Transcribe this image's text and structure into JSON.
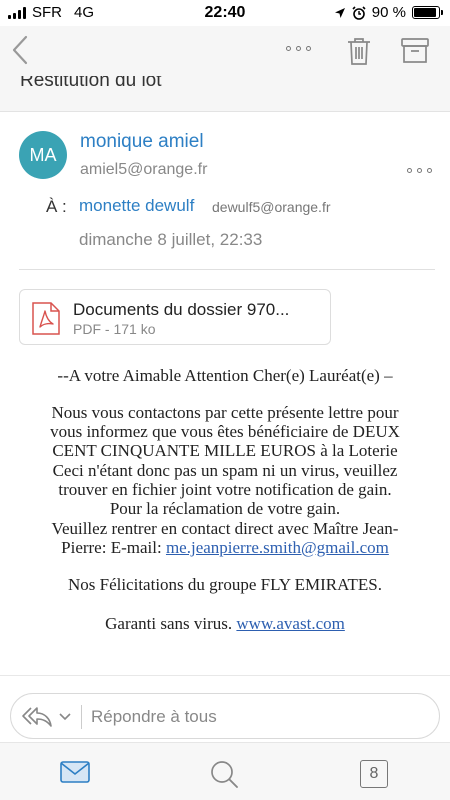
{
  "status": {
    "carrier": "SFR",
    "network": "4G",
    "time": "22:40",
    "battery_text": "90 %",
    "battery_level": 0.9
  },
  "toolbar": {
    "back_icon": "chevron-left-icon",
    "more_icon": "more-icon",
    "delete_icon": "trash-icon",
    "archive_icon": "archive-icon"
  },
  "email": {
    "subject": "Restitution du lot",
    "sender": {
      "initials": "MA",
      "name": "monique amiel",
      "email": "amiel5@orange.fr",
      "avatar_color": "#3aa3b4"
    },
    "to_label": "À :",
    "recipient": {
      "name": "monette dewulf",
      "email": "dewulf5@orange.fr"
    },
    "date": "dimanche 8 juillet, 22:33",
    "attachment": {
      "name": "Documents du dossier 970...",
      "meta": "PDF - 171 ko"
    },
    "body": {
      "greeting": "--A votre Aimable Attention Cher(e) Lauréat(e) –",
      "line1": "Nous vous contactons par cette présente lettre pour",
      "line2": "vous informez que vous êtes bénéficiaire de DEUX",
      "line3": "CENT CINQUANTE MILLE EUROS à la Loterie",
      "line4": "Ceci n'étant donc pas un spam ni un virus, veuillez",
      "line5": "trouver en fichier joint votre notification de gain.",
      "line6": "Pour la réclamation de votre gain.",
      "line7": "Veuillez rentrer en contact direct avec Maître Jean-",
      "line8_prefix": "Pierre: E-mail: ",
      "line8_link": "me.jeanpierre.smith@gmail.com",
      "congrats": "Nos Félicitations du groupe FLY EMIRATES.",
      "antivirus_prefix": "Garanti sans virus. ",
      "antivirus_link": "www.avast.com"
    }
  },
  "reply": {
    "placeholder": "Répondre à tous"
  },
  "tabbar": {
    "calendar_day": "8"
  },
  "colors": {
    "accent": "#2d7fc4",
    "link": "#2d5fb0"
  }
}
